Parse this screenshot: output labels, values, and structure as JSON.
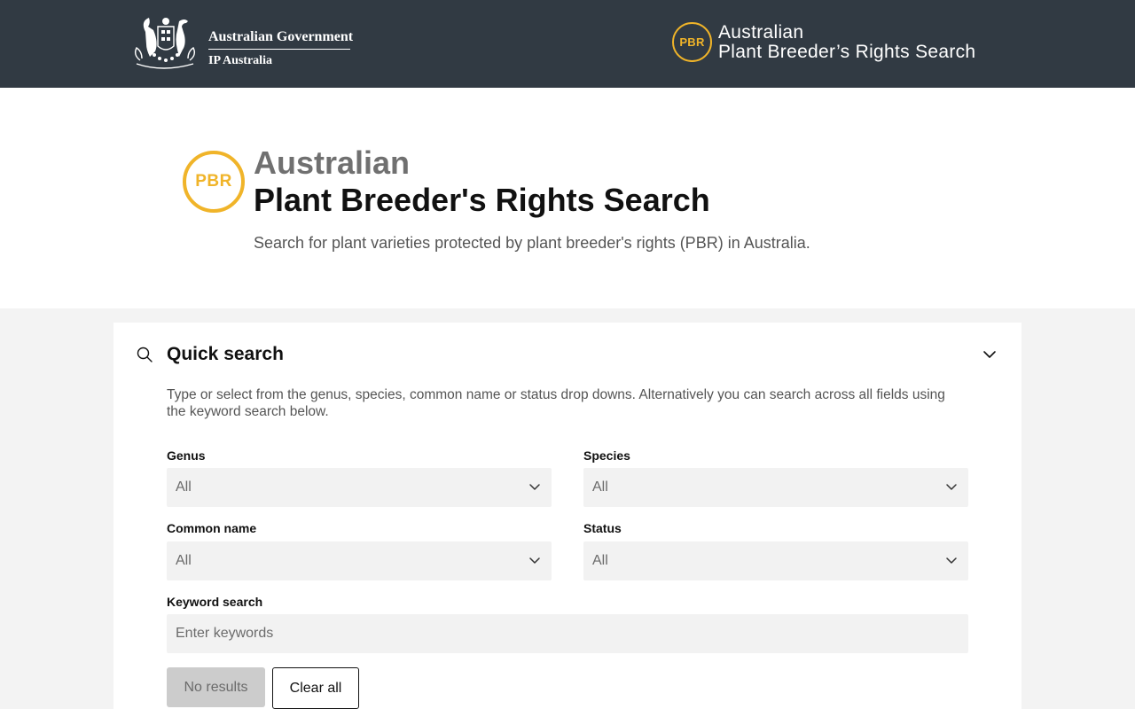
{
  "header": {
    "gov_name": "Australian Government",
    "agency": "IP Australia",
    "brand_badge": "PBR",
    "brand_line1": "Australian",
    "brand_line2": "Plant Breeder’s Rights Search"
  },
  "hero": {
    "badge": "PBR",
    "title_line1": "Australian",
    "title_line2": "Plant Breeder's Rights Search",
    "subtitle": "Search for plant varieties protected by plant breeder's rights (PBR) in Australia."
  },
  "quick_search": {
    "title": "Quick search",
    "description": "Type or select from the genus, species, common name or status drop downs. Alternatively you can search across all fields using the keyword search below.",
    "fields": {
      "genus": {
        "label": "Genus",
        "value": "All"
      },
      "species": {
        "label": "Species",
        "value": "All"
      },
      "common_name": {
        "label": "Common name",
        "value": "All"
      },
      "status": {
        "label": "Status",
        "value": "All"
      }
    },
    "keyword": {
      "label": "Keyword search",
      "placeholder": "Enter keywords"
    },
    "buttons": {
      "no_results": "No results",
      "clear_all": "Clear all"
    }
  },
  "colors": {
    "header_bg": "#313a43",
    "accent": "#f0b429",
    "page_bg": "#f3f3f3",
    "input_bg": "#f2f2f2"
  },
  "icons": [
    "coat-of-arms-icon",
    "search-icon",
    "chevron-up-icon",
    "chevron-down-icon"
  ]
}
